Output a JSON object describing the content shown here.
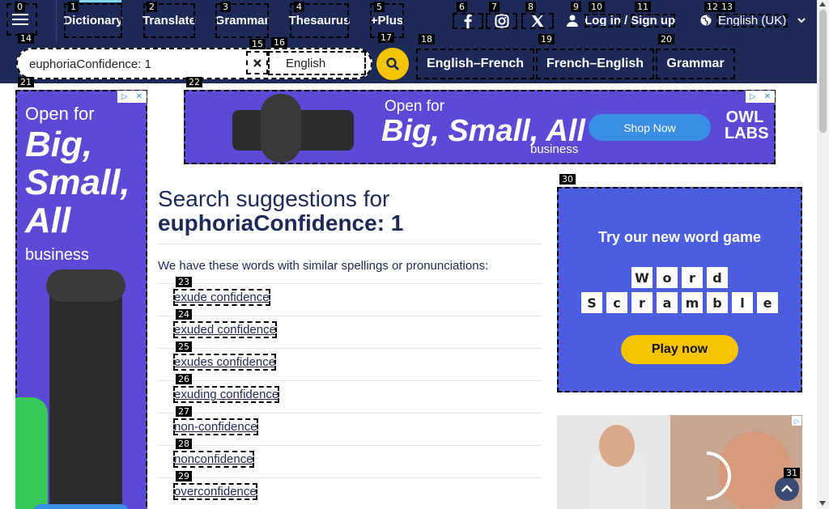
{
  "nav": {
    "links": [
      {
        "label": "Dictionary"
      },
      {
        "label": "Translate"
      },
      {
        "label": "Grammar"
      },
      {
        "label": "Thesaurus"
      },
      {
        "label": "+Plus"
      }
    ],
    "social": [
      "facebook-icon",
      "instagram-icon",
      "x-icon"
    ],
    "login": "Log in",
    "slash": "/",
    "signup": "Sign up",
    "language": "English (UK)"
  },
  "search": {
    "value": "euphoriaConfidence: 1",
    "dictionary_lang": "English"
  },
  "dict_links": [
    "English–French",
    "French–English",
    "Grammar"
  ],
  "ads": {
    "left": {
      "open": "Open for",
      "big": "Big, Small, All",
      "biz": "business"
    },
    "top": {
      "open": "Open for",
      "big": "Big, Small, All",
      "biz": "business",
      "cta": "Shop Now",
      "brand": "OWL LABS"
    },
    "game": {
      "title": "Try our new word game",
      "row1": [
        "W",
        "o",
        "r",
        "d"
      ],
      "row2": [
        "S",
        "c",
        "r",
        "a",
        "m",
        "b",
        "l",
        "e"
      ],
      "cta": "Play now"
    }
  },
  "main": {
    "heading_prefix": "Search suggestions for",
    "heading_term": "euphoriaConfidence: 1",
    "intro": "We have these words with similar spellings or pronunciations:",
    "suggestions": [
      "exude confidence",
      "exuded confidence",
      "exudes confidence",
      "exuding confidence",
      "non-confidence",
      "nonconfidence",
      "overconfidence"
    ]
  },
  "tags": [
    "0",
    "1",
    "2",
    "3",
    "4",
    "5",
    "6",
    "7",
    "8",
    "9",
    "10",
    "11",
    "12",
    "13",
    "14",
    "15",
    "16",
    "17",
    "18",
    "19",
    "20",
    "21",
    "22",
    "23",
    "24",
    "25",
    "26",
    "27",
    "28",
    "29",
    "30",
    "31"
  ],
  "colors": {
    "nav_bg": "#1d2a57",
    "accent_yellow": "#f6c300",
    "ad_purple": "#5b4ad6",
    "game_blue": "#4c5ee0"
  }
}
